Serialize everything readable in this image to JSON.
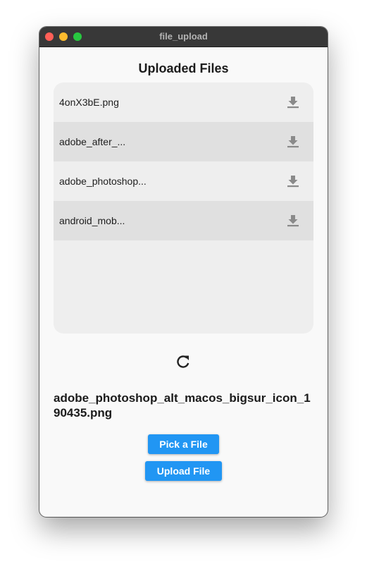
{
  "window": {
    "title": "file_upload"
  },
  "main": {
    "heading": "Uploaded Files",
    "files": [
      {
        "name": "4onX3bE.png",
        "action_icon": "download-icon"
      },
      {
        "name": "adobe_after_...",
        "action_icon": "download-icon"
      },
      {
        "name": "adobe_photoshop...",
        "action_icon": "download-icon"
      },
      {
        "name": "android_mob...",
        "action_icon": "download-icon"
      }
    ],
    "refresh_icon": "refresh-icon",
    "selected_file": "adobe_photoshop_alt_macos_bigsur_icon_190435.png",
    "pick_button": "Pick a File",
    "upload_button": "Upload File"
  },
  "colors": {
    "accent": "#2196f3",
    "titlebar": "#383838",
    "list_background": "#eeeeee",
    "row_alternate": "#e0e0e0",
    "icon": "#8a8a8a"
  }
}
